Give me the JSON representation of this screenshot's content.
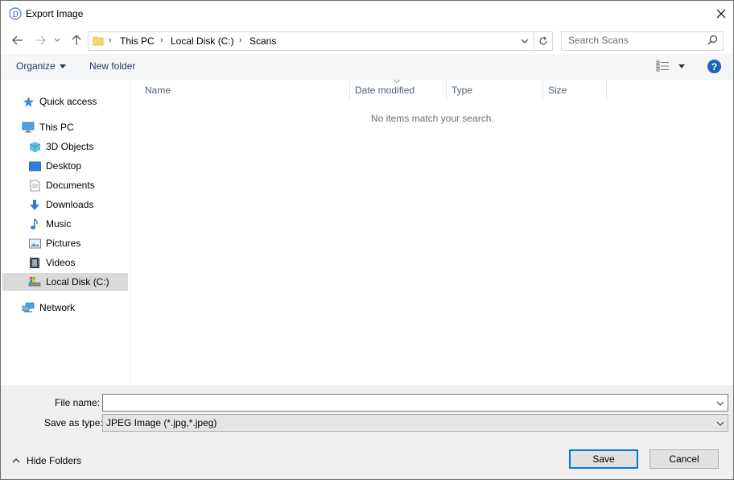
{
  "window": {
    "title": "Export Image"
  },
  "address": {
    "crumbs": [
      "This PC",
      "Local Disk (C:)",
      "Scans"
    ]
  },
  "search": {
    "placeholder": "Search Scans"
  },
  "commands": {
    "organize": "Organize",
    "new_folder": "New folder"
  },
  "sidebar": {
    "quick_access": "Quick access",
    "this_pc": "This PC",
    "items": [
      "3D Objects",
      "Desktop",
      "Documents",
      "Downloads",
      "Music",
      "Pictures",
      "Videos",
      "Local Disk (C:)"
    ],
    "network": "Network",
    "selected": "Local Disk (C:)"
  },
  "columns": [
    "Name",
    "Date modified",
    "Type",
    "Size"
  ],
  "empty_message": "No items match your search.",
  "form": {
    "file_name_label": "File name:",
    "file_name_value": "",
    "save_type_label": "Save as type:",
    "save_type_value": "JPEG Image (*.jpg,*.jpeg)"
  },
  "footer": {
    "hide_folders": "Hide Folders",
    "save": "Save",
    "cancel": "Cancel"
  },
  "colors": {
    "accent": "#0078d7",
    "help": "#1d63b7",
    "selected_bg": "#d9d9d9",
    "command_text": "#1e395b"
  }
}
